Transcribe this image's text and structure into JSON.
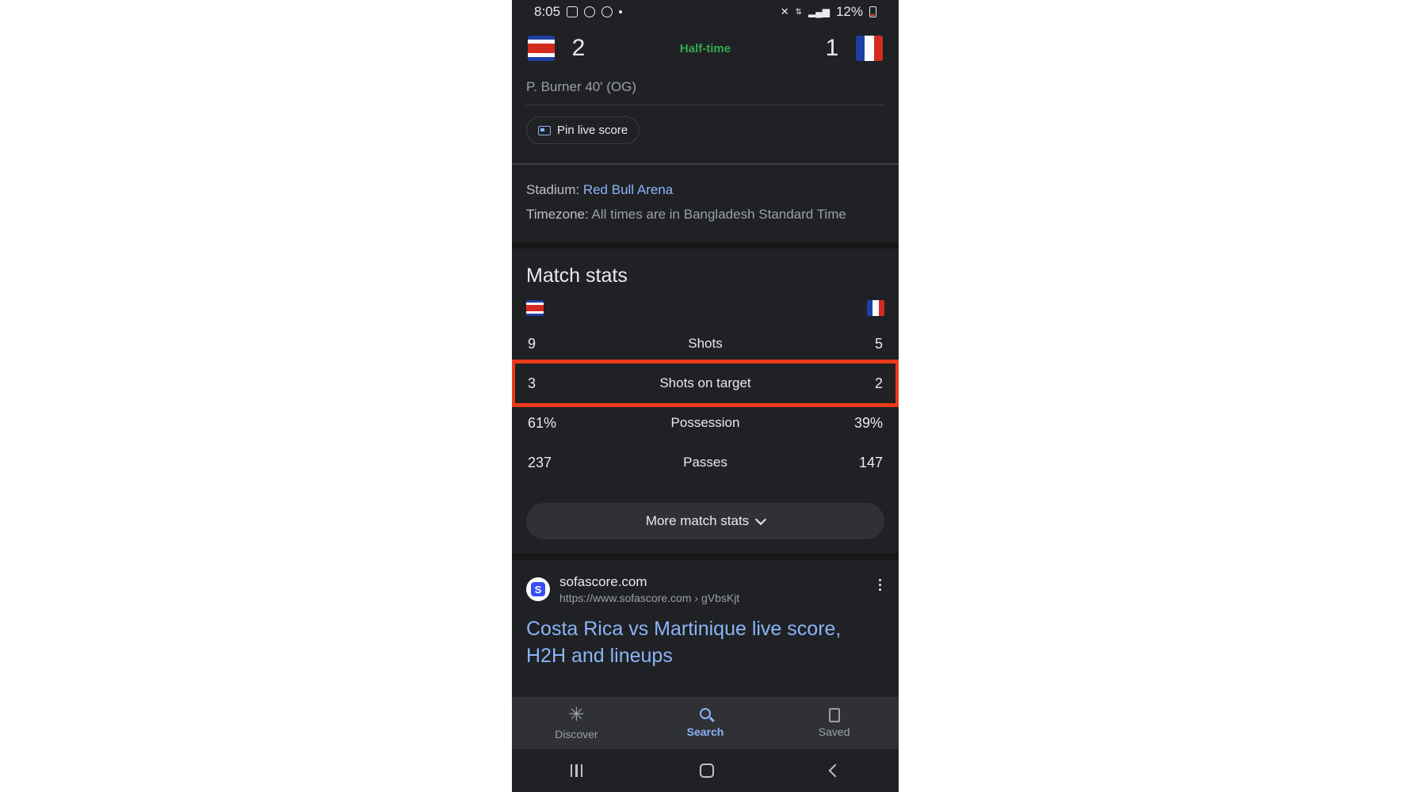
{
  "status_bar": {
    "time": "8:05",
    "battery": "12%"
  },
  "match": {
    "home_score": "2",
    "away_score": "1",
    "status": "Half-time",
    "scorer_line": "P. Burner 40' (OG)",
    "pin_label": "Pin live score",
    "stadium_label": "Stadium:",
    "stadium": "Red Bull Arena",
    "timezone_label": "Timezone:",
    "timezone": "All times are in Bangladesh Standard Time"
  },
  "stats": {
    "title": "Match stats",
    "rows": [
      {
        "home": "9",
        "label": "Shots",
        "away": "5"
      },
      {
        "home": "3",
        "label": "Shots on target",
        "away": "2"
      },
      {
        "home": "61%",
        "label": "Possession",
        "away": "39%"
      },
      {
        "home": "237",
        "label": "Passes",
        "away": "147"
      }
    ],
    "more_label": "More match stats"
  },
  "result": {
    "site": "sofascore.com",
    "url": "https://www.sofascore.com › gVbsKjt",
    "title": "Costa Rica vs Martinique live score, H2H and lineups"
  },
  "bottom_nav": {
    "discover": "Discover",
    "search": "Search",
    "saved": "Saved"
  },
  "colors": {
    "highlight": "#ea3a1a",
    "link": "#8ab4f8",
    "halftime": "#34a853"
  }
}
